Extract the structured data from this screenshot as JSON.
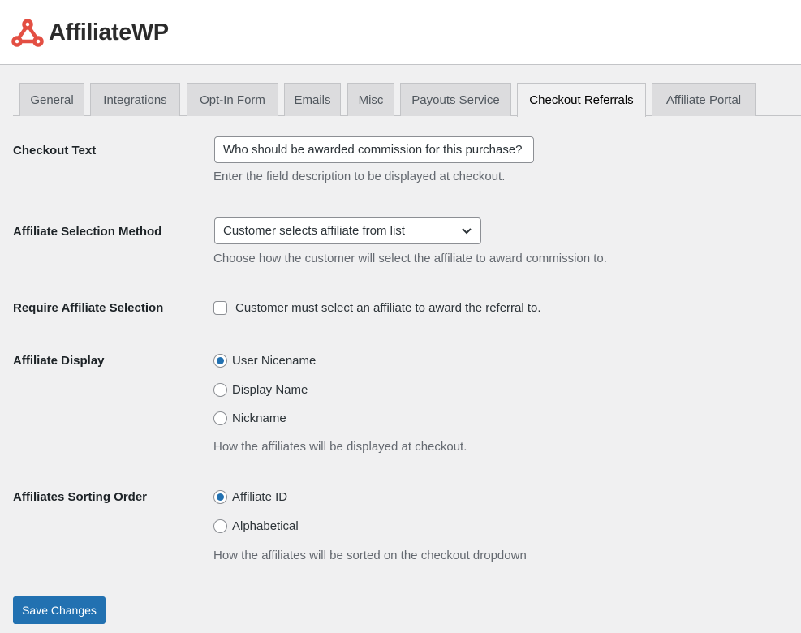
{
  "brand": {
    "name": "AffiliateWP",
    "color": "#e34f43"
  },
  "tabs": [
    {
      "label": "General"
    },
    {
      "label": "Integrations"
    },
    {
      "label": "Opt-In Form"
    },
    {
      "label": "Emails"
    },
    {
      "label": "Misc"
    },
    {
      "label": "Payouts Service"
    },
    {
      "label": "Checkout Referrals",
      "active": true
    },
    {
      "label": "Affiliate Portal"
    }
  ],
  "settings": {
    "checkout_text": {
      "label": "Checkout Text",
      "value": "Who should be awarded commission for this purchase?",
      "description": "Enter the field description to be displayed at checkout."
    },
    "selection_method": {
      "label": "Affiliate Selection Method",
      "value": "Customer selects affiliate from list",
      "description": "Choose how the customer will select the affiliate to award commission to."
    },
    "require_selection": {
      "label": "Require Affiliate Selection",
      "checkbox_label": "Customer must select an affiliate to award the referral to.",
      "checked": false
    },
    "display": {
      "label": "Affiliate Display",
      "options": [
        "User Nicename",
        "Display Name",
        "Nickname"
      ],
      "selected": "User Nicename",
      "description": "How the affiliates will be displayed at checkout."
    },
    "sorting": {
      "label": "Affiliates Sorting Order",
      "options": [
        "Affiliate ID",
        "Alphabetical"
      ],
      "selected": "Affiliate ID",
      "description": "How the affiliates will be sorted on the checkout dropdown"
    }
  },
  "save_label": "Save Changes",
  "accent": "#2271b1"
}
